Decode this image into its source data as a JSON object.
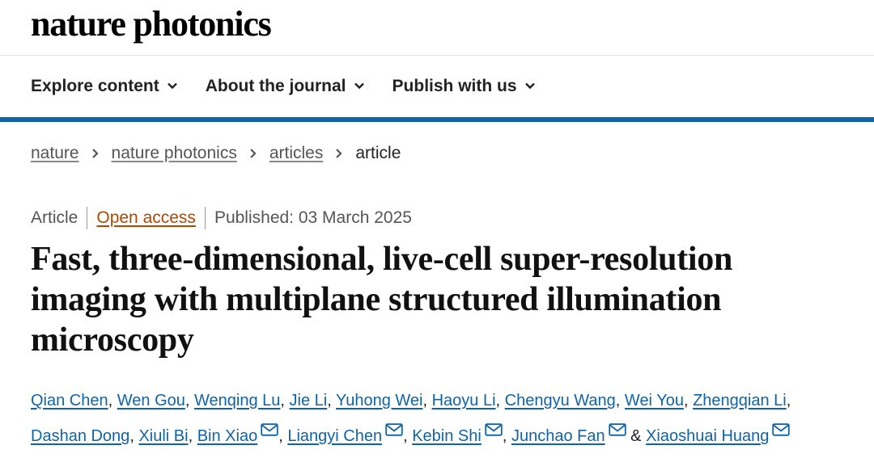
{
  "site": {
    "logo": "nature photonics"
  },
  "nav": {
    "items": [
      "Explore content",
      "About the journal",
      "Publish with us"
    ]
  },
  "breadcrumb": {
    "items": [
      "nature",
      "nature photonics",
      "articles"
    ],
    "current": "article"
  },
  "article": {
    "type": "Article",
    "access": "Open access",
    "published": "Published: 03 March 2025",
    "title": "Fast, three-dimensional, live-cell super-resolution imaging with multiplane structured illumination microscopy"
  },
  "authors": {
    "names": [
      "Qian Chen",
      "Wen Gou",
      "Wenqing Lu",
      "Jie Li",
      "Yuhong Wei",
      "Haoyu Li",
      "Chengyu Wang",
      "Wei You",
      "Zhengqian Li",
      "Dashan Dong",
      "Xiuli Bi",
      "Bin Xiao",
      "Liangyi Chen",
      "Kebin Shi",
      "Junchao Fan",
      "Xiaoshuai Huang"
    ],
    "separator": ",",
    "last_joiner": "&",
    "corresponding": [
      "Bin Xiao",
      "Liangyi Chen",
      "Kebin Shi",
      "Junchao Fan",
      "Xiaoshuai Huang"
    ]
  },
  "colors": {
    "accent": "#0f64a8",
    "open_access": "#b34700"
  },
  "icons": {
    "nav_chevron": "chevron-down-icon",
    "breadcrumb_separator": "chevron-right-icon",
    "email": "mail-icon"
  }
}
